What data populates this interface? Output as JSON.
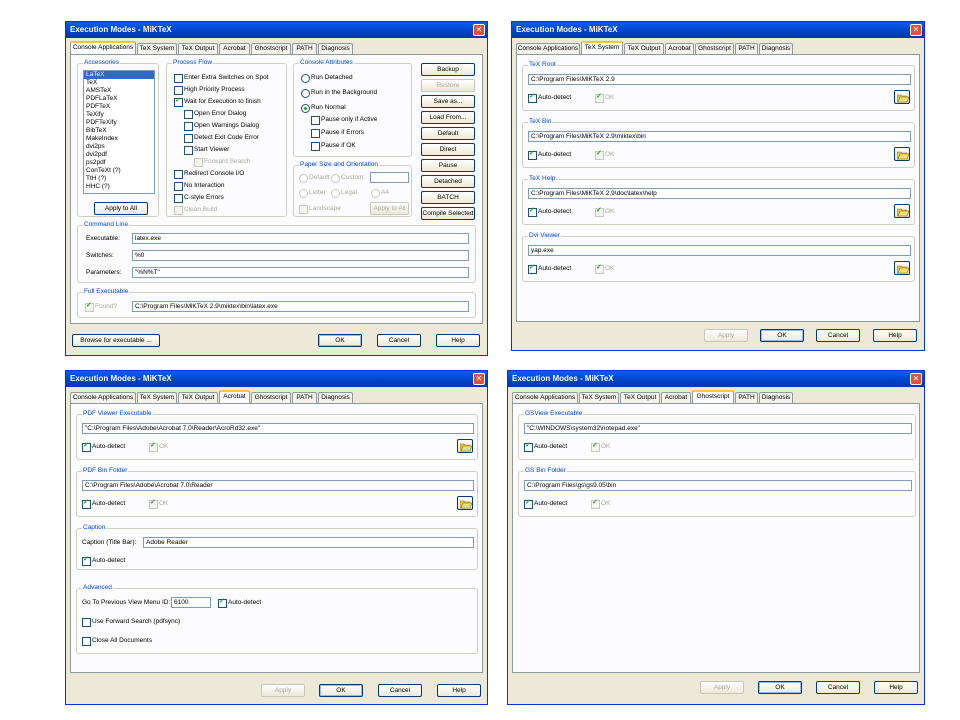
{
  "title": "Execution Modes - MiKTeX",
  "close": "✕",
  "tabs": [
    "Console Applications",
    "TeX System",
    "TeX Output",
    "Acrobat",
    "Ghostscript",
    "PATH",
    "Diagnosis"
  ],
  "buttons": {
    "ok": "OK",
    "cancel": "Cancel",
    "help": "Help",
    "apply": "Apply"
  },
  "autodetect": "Auto-detect",
  "ok_check": "OK",
  "console": {
    "accessories_label": "Accessories",
    "items": [
      "LaTeX",
      "TeX",
      "AMSTeX",
      "PDFLaTeX",
      "PDFTeX",
      "TeXify",
      "PDFTeXify",
      "BibTeX",
      "MakeIndex",
      "dvi2ps",
      "dvi2pdf",
      "ps2pdf",
      "ConTeXt  (?)",
      "TtH  (?)",
      "HHC  (?)"
    ],
    "apply_to_all": "Apply to All",
    "process_flow_label": "Process Flow",
    "pf": [
      "Enter Extra Switches on Spot",
      "High Priority Process",
      "Wait for Execution to finish",
      "Open Error Dialog",
      "Open Warnings Dialog",
      "Detect Exit Code Error",
      "Start Viewer",
      "Forward Search",
      "Redirect Console I/O",
      "No Interaction",
      "C-style Errors",
      "Clean Build"
    ],
    "console_attr_label": "Console Attributes",
    "ca": [
      "Run Detached",
      "Run in the Background",
      "Run Normal",
      "Pause only if Active",
      "Pause if Errors",
      "Pause if OK"
    ],
    "paper_label": "Paper Size and Orientation",
    "paper": [
      "Default",
      "Custom:",
      "Letter",
      "Legal",
      "A4",
      "Landscape"
    ],
    "paper_apply": "Apply to All",
    "side": [
      "Backup",
      "Restore",
      "Save as...",
      "Load From...",
      "Default",
      "Direct",
      "Pause",
      "Detached",
      "BATCH",
      "Compile Selected"
    ],
    "cmdline_label": "Command Line",
    "exe_label": "Executable:",
    "exe": "latex.exe",
    "sw_label": "Switches:",
    "sw": "%0",
    "par_label": "Parameters:",
    "par": "\"%N%T\"",
    "full_label": "Full Executable",
    "found": "Found?",
    "full": "C:\\Program Files\\MiKTeX 2.9\\miktex\\bin\\latex.exe",
    "browse": "Browse for executable ..."
  },
  "texsys": {
    "groups": [
      {
        "label": "TeX Root",
        "path": "C:\\Program Files\\MiKTeX 2.9"
      },
      {
        "label": "TeX Bin",
        "path": "C:\\Program Files\\MiKTeX 2.9\\miktex\\bin"
      },
      {
        "label": "TeX Help",
        "path": "C:\\Program Files\\MiKTeX 2.9\\doc\\latex\\help"
      },
      {
        "label": "Dvi Viewer",
        "path": "yap.exe"
      }
    ]
  },
  "acrobat": {
    "g1": {
      "label": "PDF Viewer Executable",
      "path": "\"C:\\Program Files\\Adobe\\Acrobat 7.0\\Reader\\AcroRd32.exe\""
    },
    "g2": {
      "label": "PDF Bin Folder",
      "path": "C:\\Program Files\\Adobe\\Acrobat 7.0\\Reader"
    },
    "caption_label": "Caption",
    "caption_field": "Caption (Title Bar):",
    "caption": "Adobe Reader",
    "adv_label": "Advanced",
    "goto_label": "Go To Previous View Menu ID:",
    "goto": "6100",
    "fwd": "Use Forward Search (pdfsync)",
    "close_all": "Close All Documents"
  },
  "gs": {
    "g1": {
      "label": "GSView Executable",
      "path": "\"C:\\WINDOWS\\system32\\notepad.exe\""
    },
    "g2": {
      "label": "GS Bin Folder",
      "path": "C:\\Program Files\\gs\\gs9.05\\bin"
    }
  }
}
